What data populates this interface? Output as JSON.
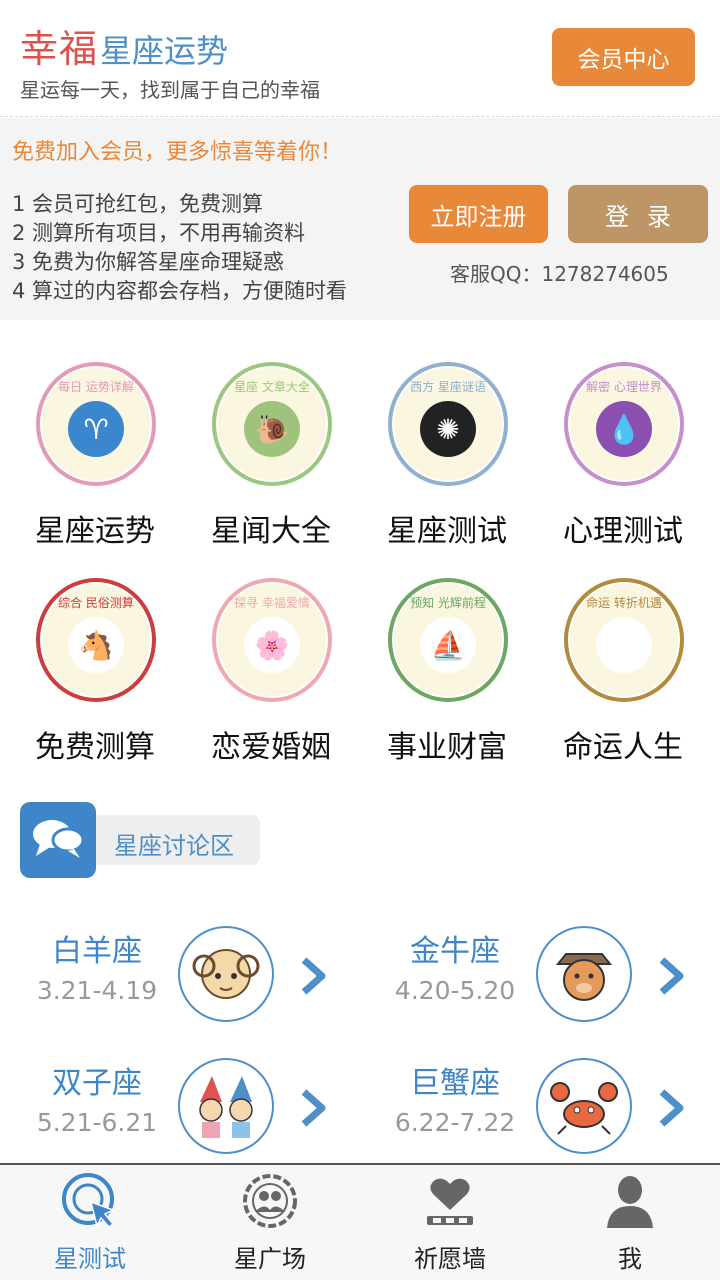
{
  "header": {
    "brand_main": "幸福",
    "brand_sub": "星座运势",
    "slogan": "星运每一天，找到属于自己的幸福",
    "vip_button": "会员中心"
  },
  "member": {
    "title": "免费加入会员，更多惊喜等着你！",
    "benefits": [
      "1 会员可抢红包，免费测算",
      "2 测算所有项目，不用再输资料",
      "3 免费为你解答星座命理疑惑",
      "4 算过的内容都会存档，方便随时看"
    ],
    "register_button": "立即注册",
    "login_button": "登录",
    "service_qq": "客服QQ：1278274605"
  },
  "features": [
    {
      "label": "星座运势",
      "caption": "每日 运势详解",
      "icon": "aries-icon",
      "ring": "#e39ab7",
      "icon_bg": "#3a86cf",
      "glyph": "♈"
    },
    {
      "label": "星闻大全",
      "caption": "星座 文章大全",
      "icon": "snail-icon",
      "ring": "#9cc77f",
      "icon_bg": "#9fc37d",
      "glyph": "🐌"
    },
    {
      "label": "星座测试",
      "caption": "西方 星座谜语",
      "icon": "zodiac-wheel-icon",
      "ring": "#8fb0cf",
      "icon_bg": "#222222",
      "glyph": "✺"
    },
    {
      "label": "心理测试",
      "caption": "解密 心理世界",
      "icon": "purple-drop-icon",
      "ring": "#c48fcb",
      "icon_bg": "#8a4fb0",
      "glyph": "💧"
    },
    {
      "label": "免费测算",
      "caption": "综合 民俗测算",
      "icon": "horse-icon",
      "ring": "#cc3d3d",
      "icon_bg": "#ffffff",
      "glyph": "🐴"
    },
    {
      "label": "恋爱婚姻",
      "caption": "探寻 幸福爱情",
      "icon": "flower-icon",
      "ring": "#f0a8b0",
      "icon_bg": "#ffffff",
      "glyph": "🌸"
    },
    {
      "label": "事业财富",
      "caption": "预知 光辉前程",
      "icon": "sailboat-icon",
      "ring": "#6ca862",
      "icon_bg": "#ffffff",
      "glyph": "⛵"
    },
    {
      "label": "命运人生",
      "caption": "命运 转折机遇",
      "icon": "helm-wheel-icon",
      "ring": "#b48a3e",
      "icon_bg": "#ffffff",
      "glyph": "☸"
    }
  ],
  "discussion": {
    "label": "星座讨论区",
    "icon": "chat-bubbles-icon"
  },
  "zodiac": [
    {
      "name": "白羊座",
      "dates": "3.21-4.19",
      "avatar": "ram-avatar"
    },
    {
      "name": "金牛座",
      "dates": "4.20-5.20",
      "avatar": "bull-avatar"
    },
    {
      "name": "双子座",
      "dates": "5.21-6.21",
      "avatar": "twins-avatar"
    },
    {
      "name": "巨蟹座",
      "dates": "6.22-7.22",
      "avatar": "crab-avatar"
    }
  ],
  "bottom_nav": [
    {
      "label": "星测试",
      "icon": "target-cursor-icon",
      "active": true
    },
    {
      "label": "星广场",
      "icon": "people-circle-icon",
      "active": false
    },
    {
      "label": "祈愿墙",
      "icon": "heart-wall-icon",
      "active": false
    },
    {
      "label": "我",
      "icon": "user-icon",
      "active": false
    }
  ],
  "colors": {
    "accent_orange": "#e8893a",
    "accent_blue": "#3f86c8",
    "brand_red": "#d9534f",
    "login_tan": "#bd9566"
  }
}
